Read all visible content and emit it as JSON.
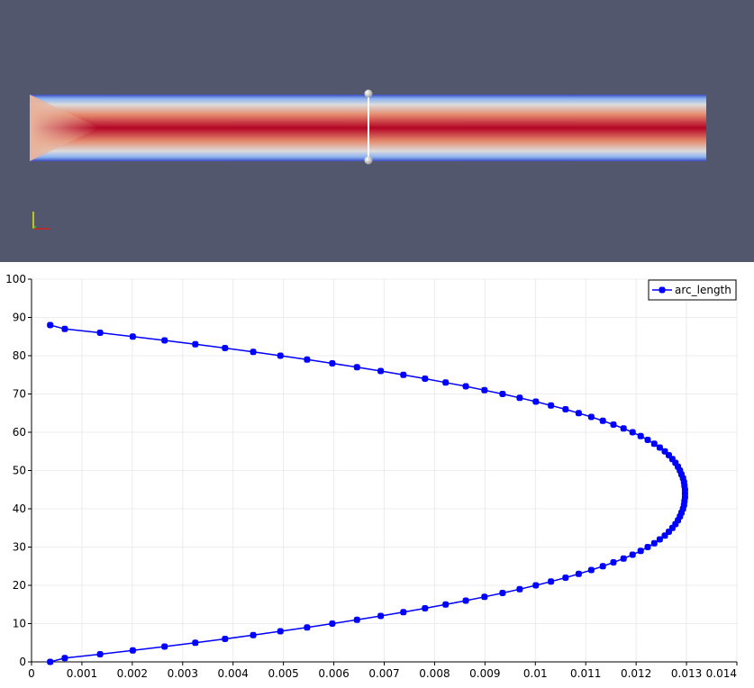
{
  "render_view": {
    "background": "#52576e",
    "colormap": [
      "#3b4cc0",
      "#dcdcdc",
      "#b40426"
    ]
  },
  "chart_data": {
    "type": "scatter",
    "style": "line-with-markers",
    "title": "",
    "xlabel": "",
    "ylabel": "",
    "xlim": [
      0,
      0.014
    ],
    "ylim": [
      0,
      100
    ],
    "xticks": [
      0,
      0.001,
      0.002,
      0.003,
      0.004,
      0.005,
      0.006,
      0.007,
      0.008,
      0.009,
      0.01,
      0.011,
      0.012,
      0.013,
      0.014
    ],
    "yticks": [
      0,
      10,
      20,
      30,
      40,
      50,
      60,
      70,
      80,
      90,
      100
    ],
    "xtick_labels": [
      "0",
      "0.001",
      "0.002",
      "0.003",
      "0.004",
      "0.005",
      "0.006",
      "0.007",
      "0.008",
      "0.009",
      "0.01",
      "0.011",
      "0.012",
      "0.013",
      "0.014"
    ],
    "ytick_labels": [
      "0",
      "10",
      "20",
      "30",
      "40",
      "50",
      "60",
      "70",
      "80",
      "90",
      "100"
    ],
    "grid": true,
    "legend_position": "top-right",
    "series": [
      {
        "name": "arc_length",
        "color": "#0000ff",
        "x": [
          0.00037,
          0.00066,
          0.00136,
          0.00201,
          0.00264,
          0.00325,
          0.00384,
          0.0044,
          0.00494,
          0.00547,
          0.00597,
          0.00646,
          0.00693,
          0.00738,
          0.00781,
          0.00822,
          0.00862,
          0.00899,
          0.00935,
          0.00969,
          0.01001,
          0.01031,
          0.0106,
          0.01086,
          0.01111,
          0.01134,
          0.01155,
          0.01175,
          0.01193,
          0.01209,
          0.01223,
          0.01236,
          0.01247,
          0.01257,
          0.01265,
          0.01272,
          0.01278,
          0.01283,
          0.01287,
          0.0129,
          0.01293,
          0.01295,
          0.01296,
          0.01297,
          0.01297,
          0.01297,
          0.01296,
          0.01295,
          0.01293,
          0.0129,
          0.01287,
          0.01283,
          0.01278,
          0.01272,
          0.01265,
          0.01257,
          0.01247,
          0.01236,
          0.01223,
          0.01209,
          0.01193,
          0.01175,
          0.01155,
          0.01134,
          0.01111,
          0.01086,
          0.0106,
          0.01031,
          0.01001,
          0.00969,
          0.00935,
          0.00899,
          0.00862,
          0.00822,
          0.00781,
          0.00738,
          0.00693,
          0.00646,
          0.00597,
          0.00547,
          0.00494,
          0.0044,
          0.00384,
          0.00325,
          0.00264,
          0.00201,
          0.00136,
          0.00066,
          0.00037
        ],
        "y": [
          0,
          1,
          2,
          3,
          4,
          5,
          6,
          7,
          8,
          9,
          10,
          11,
          12,
          13,
          14,
          15,
          16,
          17,
          18,
          19,
          20,
          21,
          22,
          23,
          24,
          25,
          26,
          27,
          28,
          29,
          30,
          31,
          32,
          33,
          34,
          35,
          36,
          37,
          38,
          39,
          40,
          41,
          42,
          43,
          44,
          45,
          46,
          47,
          48,
          49,
          50,
          51,
          52,
          53,
          54,
          55,
          56,
          57,
          58,
          59,
          60,
          61,
          62,
          63,
          64,
          65,
          66,
          67,
          68,
          69,
          70,
          71,
          72,
          73,
          74,
          75,
          76,
          77,
          78,
          79,
          80,
          81,
          82,
          83,
          84,
          85,
          86,
          87,
          88
        ]
      }
    ]
  }
}
